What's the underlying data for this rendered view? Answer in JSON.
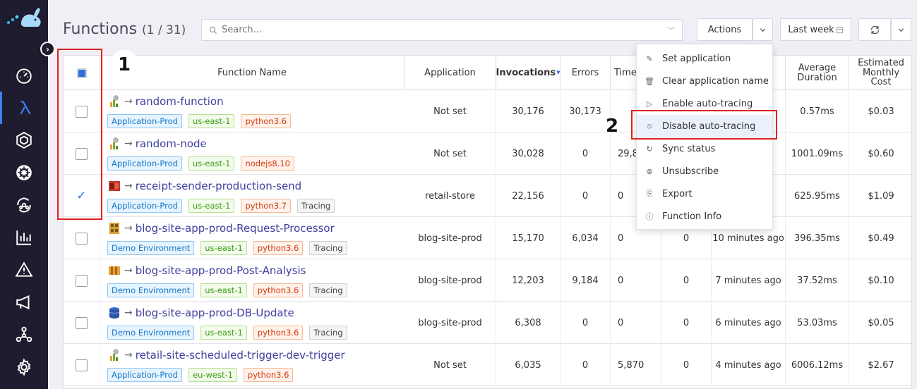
{
  "sidebar": {
    "items": [
      {
        "name": "dashboard",
        "active": false
      },
      {
        "name": "functions",
        "active": true
      },
      {
        "name": "containers",
        "active": false
      },
      {
        "name": "kubernetes",
        "active": false
      },
      {
        "name": "services",
        "active": false
      },
      {
        "name": "analytics",
        "active": false
      },
      {
        "name": "issues",
        "active": false
      },
      {
        "name": "announcements",
        "active": false
      },
      {
        "name": "architecture",
        "active": false
      },
      {
        "name": "settings",
        "active": false
      }
    ]
  },
  "header": {
    "title": "Functions",
    "count": "(1 / 31)",
    "search_placeholder": "Search...",
    "actions_label": "Actions",
    "time_range_label": "Last week"
  },
  "table": {
    "columns": {
      "name": "Function Name",
      "application": "Application",
      "invocations": "Invocations",
      "errors": "Errors",
      "timeouts": "Time",
      "avg_duration": "Average Duration",
      "monthly_cost": "Estimated Monthly Cost"
    },
    "rows": [
      {
        "name": "random-function",
        "env": "Application-Prod",
        "region": "us-east-1",
        "runtime": "python3.6",
        "tracing": "",
        "application": "Not set",
        "invocations": "30,176",
        "errors": "30,173",
        "timeouts": "",
        "col5": "",
        "last": "",
        "avg": "0.57ms",
        "cost": "$0.03",
        "checked": false,
        "icon": "lambda-func"
      },
      {
        "name": "random-node",
        "env": "Application-Prod",
        "region": "us-east-1",
        "runtime": "nodejs8.10",
        "tracing": "",
        "application": "Not set",
        "invocations": "30,028",
        "errors": "0",
        "timeouts": "29,8",
        "col5": "",
        "last": "",
        "avg": "1001.09ms",
        "cost": "$0.60",
        "checked": false,
        "icon": "lambda-func"
      },
      {
        "name": "receipt-sender-production-send",
        "env": "Application-Prod",
        "region": "us-east-1",
        "runtime": "python3.7",
        "tracing": "Tracing",
        "application": "retail-store",
        "invocations": "22,156",
        "errors": "0",
        "timeouts": "0",
        "col5": "",
        "last": "",
        "avg": "625.95ms",
        "cost": "$1.09",
        "checked": true,
        "icon": "sns"
      },
      {
        "name": "blog-site-app-prod-Request-Processor",
        "env": "Demo Environment",
        "region": "us-east-1",
        "runtime": "python3.6",
        "tracing": "Tracing",
        "application": "blog-site-prod",
        "invocations": "15,170",
        "errors": "6,034",
        "timeouts": "0",
        "col5": "0",
        "last": "10 minutes ago",
        "avg": "396.35ms",
        "cost": "$0.49",
        "checked": false,
        "icon": "api-gw"
      },
      {
        "name": "blog-site-app-prod-Post-Analysis",
        "env": "Demo Environment",
        "region": "us-east-1",
        "runtime": "python3.6",
        "tracing": "Tracing",
        "application": "blog-site-prod",
        "invocations": "12,203",
        "errors": "9,184",
        "timeouts": "0",
        "col5": "0",
        "last": "7 minutes ago",
        "avg": "37.52ms",
        "cost": "$0.10",
        "checked": false,
        "icon": "kinesis"
      },
      {
        "name": "blog-site-app-prod-DB-Update",
        "env": "Demo Environment",
        "region": "us-east-1",
        "runtime": "python3.6",
        "tracing": "Tracing",
        "application": "blog-site-prod",
        "invocations": "6,308",
        "errors": "0",
        "timeouts": "0",
        "col5": "0",
        "last": "6 minutes ago",
        "avg": "53.03ms",
        "cost": "$0.05",
        "checked": false,
        "icon": "dynamodb"
      },
      {
        "name": "retail-site-scheduled-trigger-dev-trigger",
        "env": "Application-Prod",
        "region": "eu-west-1",
        "runtime": "python3.6",
        "tracing": "",
        "application": "Not set",
        "invocations": "6,035",
        "errors": "0",
        "timeouts": "5,870",
        "col5": "0",
        "last": "4 minutes ago",
        "avg": "6006.12ms",
        "cost": "$2.67",
        "checked": false,
        "icon": "lambda-func"
      }
    ]
  },
  "menu": {
    "items": [
      {
        "label": "Set application",
        "icon": "pencil-icon",
        "glyph": "✎"
      },
      {
        "label": "Clear application name",
        "icon": "trash-icon",
        "glyph": "🗑"
      },
      {
        "label": "Enable auto-tracing",
        "icon": "play-circle-icon",
        "glyph": "▷"
      },
      {
        "label": "Disable auto-tracing",
        "icon": "ban-icon",
        "glyph": "⦸"
      },
      {
        "label": "Sync status",
        "icon": "sync-icon",
        "glyph": "↻"
      },
      {
        "label": "Unsubscribe",
        "icon": "close-circle-icon",
        "glyph": "⊗"
      },
      {
        "label": "Export",
        "icon": "export-file-icon",
        "glyph": "⎘"
      },
      {
        "label": "Function Info",
        "icon": "info-icon",
        "glyph": "ⓘ"
      }
    ],
    "highlighted_index": 3
  },
  "annotations": {
    "one": "1",
    "two": "2"
  }
}
